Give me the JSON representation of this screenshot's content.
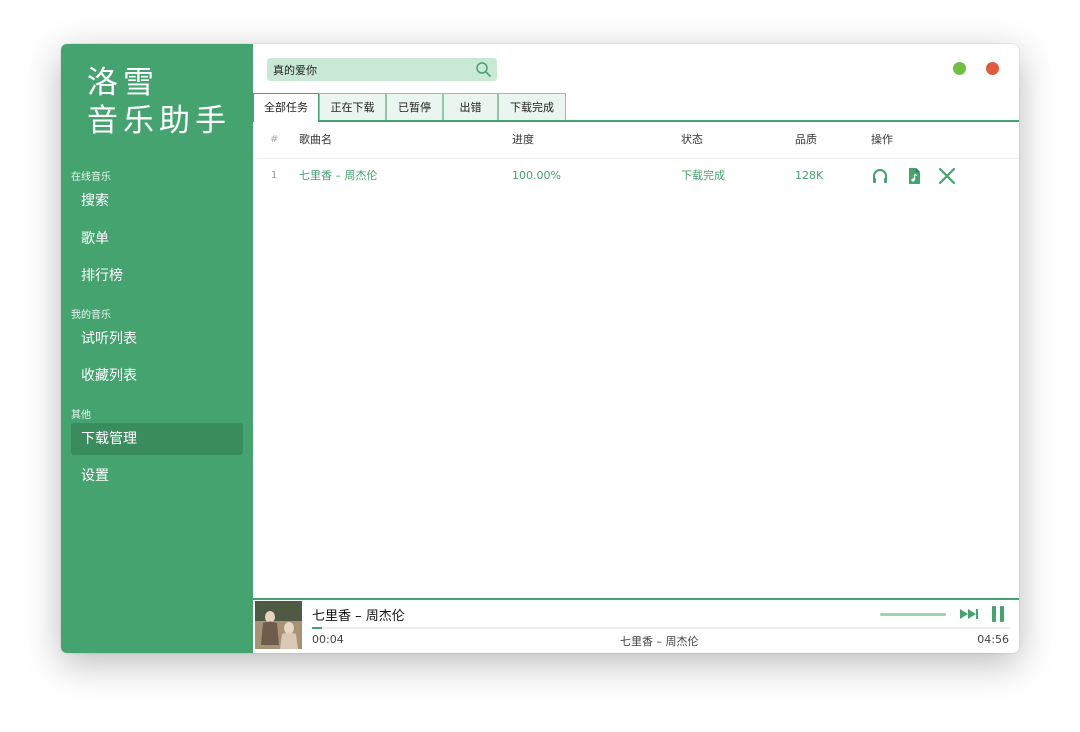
{
  "app": {
    "brand_line1": "洛雪",
    "brand_line2": "音乐助手"
  },
  "sidebar": {
    "sections": [
      {
        "label": "在线音乐",
        "items": [
          {
            "label": "搜索"
          },
          {
            "label": "歌单"
          },
          {
            "label": "排行榜"
          }
        ]
      },
      {
        "label": "我的音乐",
        "items": [
          {
            "label": "试听列表"
          },
          {
            "label": "收藏列表"
          }
        ]
      },
      {
        "label": "其他",
        "items": [
          {
            "label": "下载管理",
            "active": true
          },
          {
            "label": "设置"
          }
        ]
      }
    ]
  },
  "search": {
    "value": "真的爱你",
    "icon": "search-icon"
  },
  "tabs": [
    {
      "label": "全部任务",
      "active": true
    },
    {
      "label": "正在下载"
    },
    {
      "label": "已暂停"
    },
    {
      "label": "出错"
    },
    {
      "label": "下载完成"
    }
  ],
  "table": {
    "headers": {
      "num": "#",
      "name": "歌曲名",
      "progress": "进度",
      "status": "状态",
      "quality": "品质",
      "actions": "操作"
    },
    "rows": [
      {
        "num": "1",
        "name": "七里香 – 周杰伦",
        "progress": "100.00%",
        "status": "下载完成",
        "quality": "128K",
        "actions": [
          "headphones-icon",
          "music-file-icon",
          "close-icon"
        ]
      }
    ]
  },
  "player": {
    "title": "七里香 – 周杰伦",
    "subtitle": "七里香 – 周杰伦",
    "current_time": "00:04",
    "duration": "04:56",
    "progress_fraction": 0.014,
    "volume_fraction": 1.0
  },
  "colors": {
    "accent": "#44a36f",
    "accent_dark": "#3a8c5f",
    "search_bg": "#c9e9d6",
    "window_min": "#6fbf42",
    "window_close": "#e15a3d"
  }
}
